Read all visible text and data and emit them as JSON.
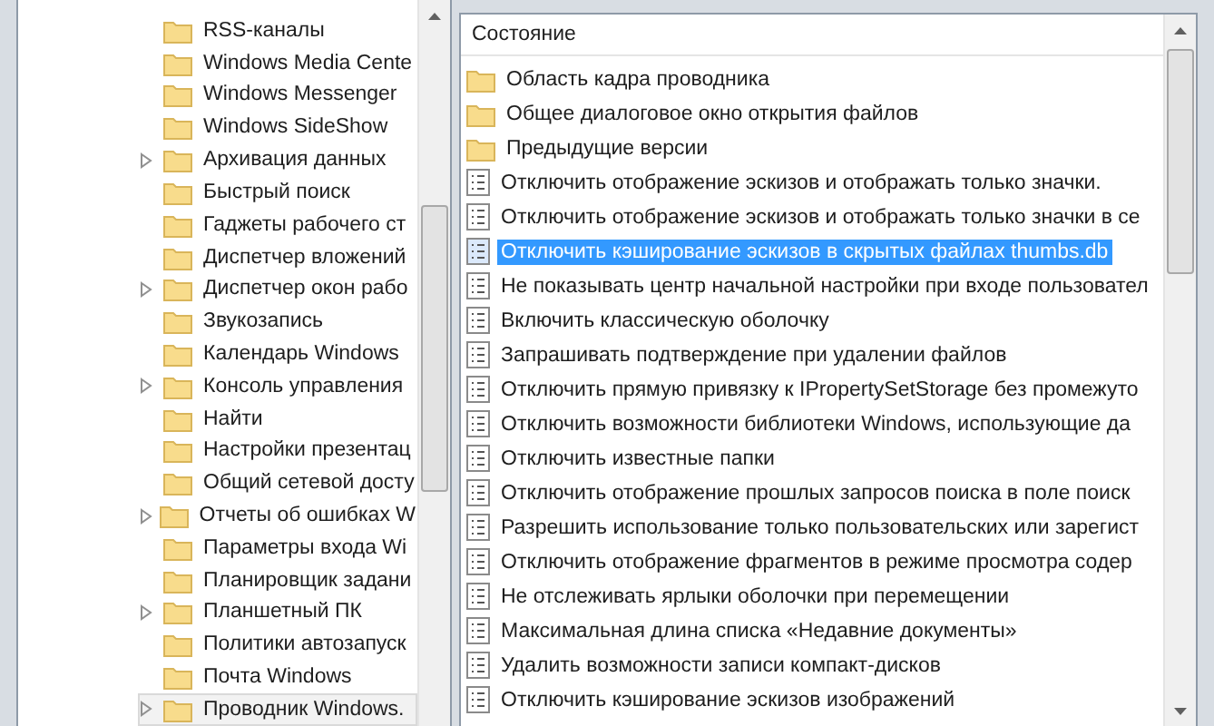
{
  "tree": {
    "items": [
      {
        "label": "RSS-каналы",
        "expandable": false,
        "selected": false
      },
      {
        "label": "Windows Media Cente",
        "expandable": false,
        "selected": false
      },
      {
        "label": "Windows Messenger",
        "expandable": false,
        "selected": false
      },
      {
        "label": "Windows SideShow",
        "expandable": false,
        "selected": false
      },
      {
        "label": "Архивация данных",
        "expandable": true,
        "selected": false
      },
      {
        "label": "Быстрый поиск",
        "expandable": false,
        "selected": false
      },
      {
        "label": "Гаджеты рабочего ст",
        "expandable": false,
        "selected": false
      },
      {
        "label": "Диспетчер вложений",
        "expandable": false,
        "selected": false
      },
      {
        "label": "Диспетчер окон рабо",
        "expandable": true,
        "selected": false
      },
      {
        "label": "Звукозапись",
        "expandable": false,
        "selected": false
      },
      {
        "label": "Календарь Windows",
        "expandable": false,
        "selected": false
      },
      {
        "label": "Консоль управления",
        "expandable": true,
        "selected": false
      },
      {
        "label": "Найти",
        "expandable": false,
        "selected": false
      },
      {
        "label": "Настройки презентац",
        "expandable": false,
        "selected": false
      },
      {
        "label": "Общий сетевой досту",
        "expandable": false,
        "selected": false
      },
      {
        "label": "Отчеты об ошибках W",
        "expandable": true,
        "selected": false
      },
      {
        "label": "Параметры входа Wi",
        "expandable": false,
        "selected": false
      },
      {
        "label": "Планировщик задани",
        "expandable": false,
        "selected": false
      },
      {
        "label": "Планшетный ПК",
        "expandable": true,
        "selected": false
      },
      {
        "label": "Политики автозапуск",
        "expandable": false,
        "selected": false
      },
      {
        "label": "Почта Windows",
        "expandable": false,
        "selected": false
      },
      {
        "label": "Проводник Windows.",
        "expandable": true,
        "selected": true
      }
    ]
  },
  "list": {
    "column": "Состояние",
    "rows": [
      {
        "kind": "folder",
        "label": "Область кадра проводника",
        "selected": false
      },
      {
        "kind": "folder",
        "label": "Общее диалоговое окно открытия файлов",
        "selected": false
      },
      {
        "kind": "folder",
        "label": "Предыдущие версии",
        "selected": false
      },
      {
        "kind": "setting",
        "label": "Отключить отображение эскизов и отображать только значки.",
        "selected": false
      },
      {
        "kind": "setting",
        "label": "Отключить отображение эскизов и отображать только значки в се",
        "selected": false
      },
      {
        "kind": "setting",
        "label": "Отключить кэширование эскизов в скрытых файлах thumbs.db",
        "selected": true
      },
      {
        "kind": "setting",
        "label": "Не показывать центр начальной настройки при входе пользовател",
        "selected": false
      },
      {
        "kind": "setting",
        "label": "Включить классическую оболочку",
        "selected": false
      },
      {
        "kind": "setting",
        "label": "Запрашивать подтверждение при удалении файлов",
        "selected": false
      },
      {
        "kind": "setting",
        "label": "Отключить прямую привязку к IPropertySetStorage без промежуто",
        "selected": false
      },
      {
        "kind": "setting",
        "label": "Отключить возможности библиотеки Windows, использующие да",
        "selected": false
      },
      {
        "kind": "setting",
        "label": "Отключить известные папки",
        "selected": false
      },
      {
        "kind": "setting",
        "label": "Отключить отображение прошлых запросов поиска в поле поиск",
        "selected": false
      },
      {
        "kind": "setting",
        "label": "Разрешить использование только пользовательских или зарегист",
        "selected": false
      },
      {
        "kind": "setting",
        "label": "Отключить отображение фрагментов в режиме просмотра содер",
        "selected": false
      },
      {
        "kind": "setting",
        "label": "Не отслеживать ярлыки оболочки при перемещении",
        "selected": false
      },
      {
        "kind": "setting",
        "label": "Максимальная длина списка «Недавние документы»",
        "selected": false
      },
      {
        "kind": "setting",
        "label": "Удалить возможности записи компакт-дисков",
        "selected": false
      },
      {
        "kind": "setting",
        "label": "Отключить кэширование эскизов изображений",
        "selected": false
      }
    ]
  }
}
